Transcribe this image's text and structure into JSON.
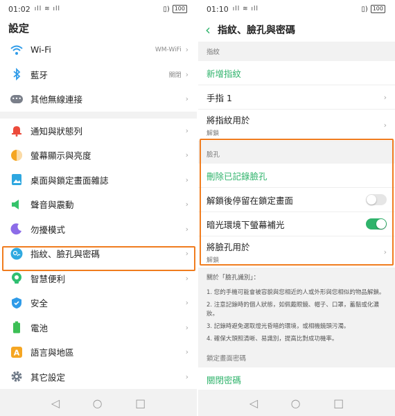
{
  "left": {
    "status": {
      "time": "01:02",
      "signal": "ıll ≋ ıll",
      "battery": "100"
    },
    "title": "設定",
    "groups": [
      [
        {
          "label": "Wi-Fi",
          "value": "WM-WiFi",
          "icon": "wifi-icon",
          "color": "#2f9be8"
        },
        {
          "label": "藍牙",
          "value": "關閉",
          "icon": "bluetooth-icon",
          "color": "#2f9be8"
        },
        {
          "label": "其他無線連接",
          "value": "",
          "icon": "more-connections-icon",
          "color": "#7a7f8a"
        }
      ],
      [
        {
          "label": "通知與狀態列",
          "value": "",
          "icon": "notification-bell-icon",
          "color": "#ec4b3c"
        },
        {
          "label": "螢幕顯示與亮度",
          "value": "",
          "icon": "brightness-icon",
          "color": "#f5a623"
        },
        {
          "label": "桌面與鎖定畫面雜誌",
          "value": "",
          "icon": "wallpaper-icon",
          "color": "#2ea7e0"
        },
        {
          "label": "聲音與震動",
          "value": "",
          "icon": "speaker-icon",
          "color": "#35c36b"
        },
        {
          "label": "勿擾模式",
          "value": "",
          "icon": "moon-icon",
          "color": "#8c6ce8"
        },
        {
          "label": "指紋、臉孔與密碼",
          "value": "",
          "icon": "fingerprint-face-icon",
          "color": "#2fa9e0"
        },
        {
          "label": "智慧便利",
          "value": "",
          "icon": "smart-assist-icon",
          "color": "#2fbf71"
        },
        {
          "label": "安全",
          "value": "",
          "icon": "shield-icon",
          "color": "#2f9be8"
        },
        {
          "label": "電池",
          "value": "",
          "icon": "battery-icon",
          "color": "#3cbf55"
        },
        {
          "label": "語言與地區",
          "value": "",
          "icon": "language-icon",
          "color": "#f5a623"
        },
        {
          "label": "其它設定",
          "value": "",
          "icon": "gear-icon",
          "color": "#6f7a88"
        }
      ]
    ]
  },
  "right": {
    "status": {
      "time": "01:10",
      "signal": "ıll ≋ ıll",
      "battery": "100"
    },
    "title": "指紋、臉孔與密碼",
    "fingerprint": {
      "section": "指紋",
      "add": "新增指紋",
      "finger1": "手指 1",
      "use_for": "將指紋用於",
      "use_for_sub": "解鎖"
    },
    "face": {
      "section": "臉孔",
      "delete": "刪除已記錄臉孔",
      "stay_locked": "解鎖後停留在鎖定畫面",
      "stay_locked_on": false,
      "low_light": "暗光環境下螢幕補光",
      "low_light_on": true,
      "use_for": "將臉孔用於",
      "use_for_sub": "解鎖"
    },
    "about": {
      "title": "關於「臉孔識別」：",
      "items": [
        "1. 您的手機可能會被容貌與您相近的人或外形與您相似的物品解鎖。",
        "2. 注意記錄時的個人狀態，如佩戴眼鏡、帽子、口罩，蓄鬍或化濃妝。",
        "3. 記錄時避免選取燈光昏暗的環境，或相機鏡頭污濁。",
        "4. 確保大頭照清晰、易識別，提高比對成功機率。"
      ]
    },
    "lock": {
      "section": "鎖定畫面密碼",
      "disable": "關閉密碼"
    }
  },
  "nav": {
    "back": "◁",
    "home": "○",
    "recents": "□"
  },
  "highlight_color": "#f07c1e"
}
